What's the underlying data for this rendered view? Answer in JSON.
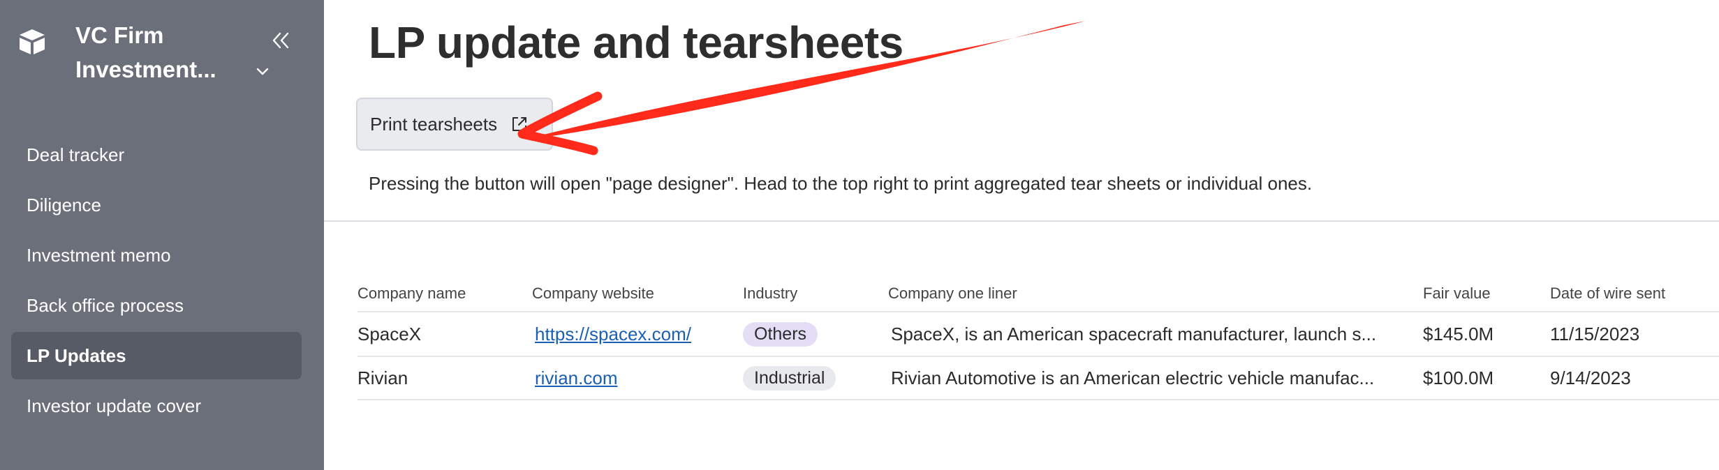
{
  "sidebar": {
    "brand_name": "VC Firm\nInvestment...",
    "items": [
      {
        "label": "Deal tracker"
      },
      {
        "label": "Diligence"
      },
      {
        "label": "Investment memo"
      },
      {
        "label": "Back office process"
      },
      {
        "label": "LP Updates",
        "active": true
      },
      {
        "label": "Investor update cover"
      }
    ]
  },
  "main": {
    "title": "LP update and tearsheets",
    "print_button_label": "Print tearsheets",
    "help_text": "Pressing the button will open \"page designer\". Head to the top right to print aggregated tear sheets or individual ones."
  },
  "table": {
    "headers": [
      "Company name",
      "Company website",
      "Industry",
      "Company one liner",
      "Fair value",
      "Date of wire sent"
    ],
    "rows": [
      {
        "name": "SpaceX",
        "website": "https://spacex.com/",
        "industry": "Others",
        "one_liner": "SpaceX, is an American spacecraft manufacturer, launch s...",
        "fair_value": "$145.0M",
        "wire_date": "11/15/2023"
      },
      {
        "name": "Rivian",
        "website": "rivian.com",
        "industry": "Industrial",
        "one_liner": "Rivian Automotive is an American electric vehicle manufac...",
        "fair_value": "$100.0M",
        "wire_date": "9/14/2023"
      }
    ]
  },
  "colors": {
    "sidebar_bg": "#6b6f7a",
    "sidebar_active": "#575b65",
    "annotation_arrow": "#ff2a1a",
    "link": "#1a5fb4",
    "tag_others": "#e3def5",
    "tag_industrial": "#e8e9ec"
  },
  "icons": [
    "box-logo-icon",
    "chevron-down-icon",
    "double-chevron-left-icon",
    "external-link-icon"
  ]
}
